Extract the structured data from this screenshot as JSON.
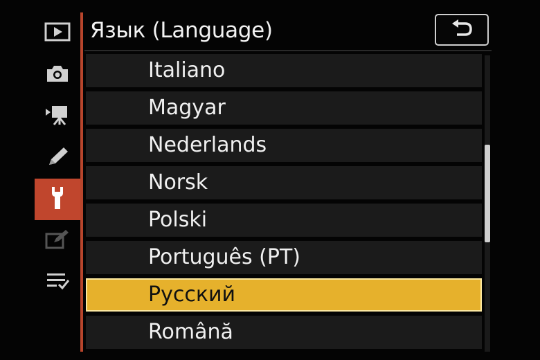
{
  "header": {
    "title": "Язык (Language)"
  },
  "sidebar": {
    "items": [
      {
        "icon": "playback-icon",
        "active": false
      },
      {
        "icon": "camera-icon",
        "active": false
      },
      {
        "icon": "movie-camera-icon",
        "active": false
      },
      {
        "icon": "pencil-icon",
        "active": false
      },
      {
        "icon": "wrench-icon",
        "active": true
      },
      {
        "icon": "retouch-icon",
        "active": false,
        "dimmed": true
      },
      {
        "icon": "my-menu-icon",
        "active": false
      }
    ]
  },
  "languages": [
    {
      "label": "Italiano",
      "selected": false
    },
    {
      "label": "Magyar",
      "selected": false
    },
    {
      "label": "Nederlands",
      "selected": false
    },
    {
      "label": "Norsk",
      "selected": false
    },
    {
      "label": "Polski",
      "selected": false
    },
    {
      "label": "Português (PT)",
      "selected": false
    },
    {
      "label": "Русский",
      "selected": true
    },
    {
      "label": "Română",
      "selected": false
    }
  ],
  "scroll": {
    "position_fraction": 0.45,
    "visible_fraction": 0.33
  },
  "colors": {
    "accent_sidebar": "#c0462d",
    "selection": "#e6b12c",
    "row_background": "#1b1b1b",
    "text": "#f0f0f0"
  }
}
